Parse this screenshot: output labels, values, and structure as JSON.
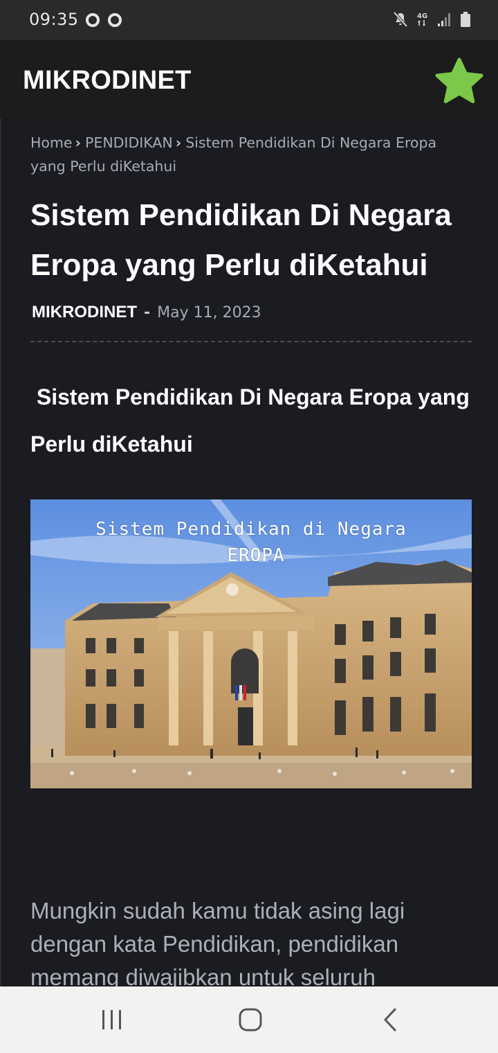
{
  "status_bar": {
    "time": "09:35",
    "network": "4G",
    "icons": [
      "opera-icon",
      "opera-icon",
      "mute-icon",
      "network-4g-icon",
      "signal-icon",
      "battery-icon"
    ]
  },
  "app_bar": {
    "title": "MIKRODINET",
    "star_icon": "star-icon",
    "star_color": "#7cc84a"
  },
  "breadcrumb": {
    "items": [
      "Home",
      "PENDIDIKAN",
      "Sistem Pendidikan Di Negara Eropa yang Perlu diKetahui"
    ],
    "separator_icon": "chevron-right-icon"
  },
  "post": {
    "title": "Sistem Pendidikan Di Negara Eropa yang Perlu diKetahui",
    "author": "MIKRODINET",
    "meta_separator": "-",
    "date": "May 11, 2023",
    "subheading": "Sistem Pendidikan Di Negara Eropa yang Perlu diKetahui",
    "image": {
      "caption_line1": "Sistem Pendidikan di Negara",
      "caption_line2": "EROPA"
    },
    "body_text": "Mungkin sudah kamu tidak asing lagi dengan kata Pendidikan, pendidikan memang diwajibkan untuk seluruh"
  },
  "nav_bar": {
    "recents_icon": "recents-icon",
    "home_icon": "home-icon",
    "back_icon": "back-icon"
  },
  "colors": {
    "background": "#1b1c22",
    "app_bar": "#1c1c1c",
    "status_bar": "#2a2a2a",
    "text_primary": "#ffffff",
    "text_muted": "#a9abb3",
    "accent": "#7cc84a",
    "nav_bar": "#f2f2f2"
  }
}
